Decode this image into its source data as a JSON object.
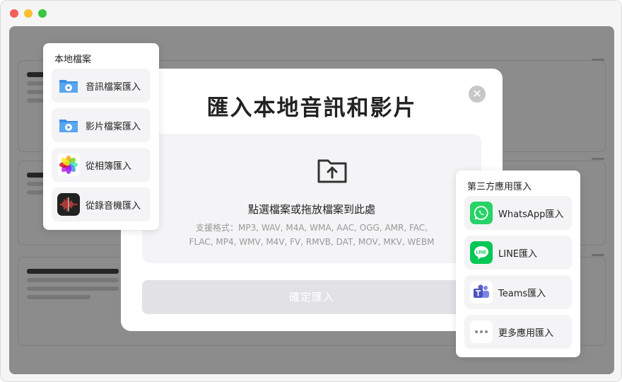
{
  "local_panel": {
    "title": "本地檔案",
    "items": [
      {
        "label": "音訊檔案匯入",
        "icon": "audio-folder-icon"
      },
      {
        "label": "影片檔案匯入",
        "icon": "video-folder-icon"
      },
      {
        "label": "從相簿匯入",
        "icon": "photos-icon"
      },
      {
        "label": "從錄音機匯入",
        "icon": "voice-memos-icon"
      }
    ]
  },
  "modal": {
    "title": "匯入本地音訊和影片",
    "drop_text": "點選檔案或拖放檔案到此處",
    "formats": "支援格式：MP3, WAV, M4A, WMA, AAC, OGG, AMR, FAC, FLAC, MP4, WMV, M4V, FV, RMVB, DAT, MOV, MKV, WEBM",
    "confirm_label": "確定匯入",
    "close_glyph": "✕"
  },
  "third_panel": {
    "title": "第三方應用匯入",
    "items": [
      {
        "label": "WhatsApp匯入",
        "icon": "whatsapp-icon"
      },
      {
        "label": "LINE匯入",
        "icon": "line-icon"
      },
      {
        "label": "Teams匯入",
        "icon": "teams-icon"
      },
      {
        "label": "更多應用匯入",
        "icon": "more-icon"
      }
    ]
  },
  "colors": {
    "whatsapp": "#25d366",
    "line": "#06c755",
    "teams": "#5b5fc7",
    "folder": "#3a8ee6"
  }
}
